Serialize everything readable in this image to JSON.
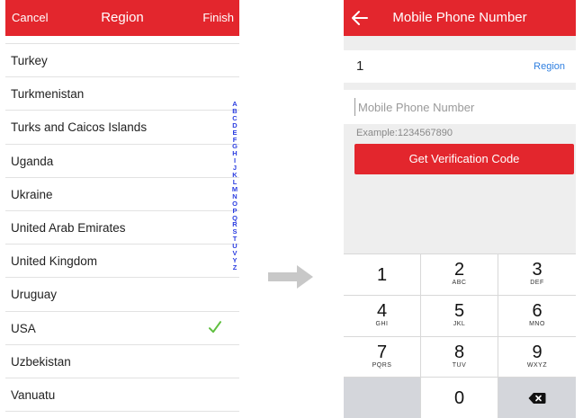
{
  "left": {
    "header": {
      "cancel": "Cancel",
      "title": "Region",
      "finish": "Finish"
    },
    "regions": [
      {
        "name": "Turkey",
        "selected": false
      },
      {
        "name": "Turkmenistan",
        "selected": false
      },
      {
        "name": "Turks and Caicos Islands",
        "selected": false
      },
      {
        "name": "Uganda",
        "selected": false
      },
      {
        "name": "Ukraine",
        "selected": false
      },
      {
        "name": "United Arab Emirates",
        "selected": false
      },
      {
        "name": "United Kingdom",
        "selected": false
      },
      {
        "name": "Uruguay",
        "selected": false
      },
      {
        "name": "USA",
        "selected": true
      },
      {
        "name": "Uzbekistan",
        "selected": false
      },
      {
        "name": "Vanuatu",
        "selected": false
      }
    ],
    "index_letters": [
      "A",
      "B",
      "C",
      "D",
      "E",
      "F",
      "G",
      "H",
      "I",
      "J",
      "K",
      "L",
      "M",
      "N",
      "O",
      "P",
      "Q",
      "R",
      "S",
      "T",
      "U",
      "V",
      "Y",
      "Z"
    ],
    "check_icon": "checkmark-icon",
    "check_color": "#5fbf3f"
  },
  "arrow_icon": "right-arrow-icon",
  "right": {
    "header": {
      "title": "Mobile Phone Number",
      "back_icon": "back-arrow-icon"
    },
    "country_code": "1",
    "region_link": "Region",
    "phone_input": {
      "value": "",
      "placeholder": "Mobile Phone Number"
    },
    "example": "Example:1234567890",
    "verify_button": "Get Verification Code",
    "keypad": [
      {
        "digit": "1",
        "letters": ""
      },
      {
        "digit": "2",
        "letters": "ABC"
      },
      {
        "digit": "3",
        "letters": "DEF"
      },
      {
        "digit": "4",
        "letters": "GHI"
      },
      {
        "digit": "5",
        "letters": "JKL"
      },
      {
        "digit": "6",
        "letters": "MNO"
      },
      {
        "digit": "7",
        "letters": "PQRS"
      },
      {
        "digit": "8",
        "letters": "TUV"
      },
      {
        "digit": "9",
        "letters": "WXYZ"
      },
      {
        "digit": "",
        "letters": ""
      },
      {
        "digit": "0",
        "letters": ""
      },
      {
        "digit": "",
        "letters": "",
        "icon": "backspace-icon"
      }
    ]
  },
  "colors": {
    "accent": "#e3262d",
    "link": "#2f7fe0",
    "index": "#2b3de0"
  }
}
